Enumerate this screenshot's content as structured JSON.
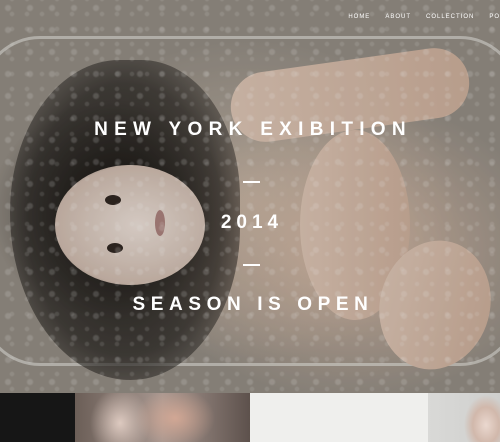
{
  "nav": {
    "items": [
      {
        "label": "HOME"
      },
      {
        "label": "ABOUT"
      },
      {
        "label": "COLLECTION"
      },
      {
        "label": "PO"
      }
    ]
  },
  "hero": {
    "line1": "NEW YORK EXIBITION",
    "line2": "2014",
    "line3": "SEASON IS OPEN"
  }
}
